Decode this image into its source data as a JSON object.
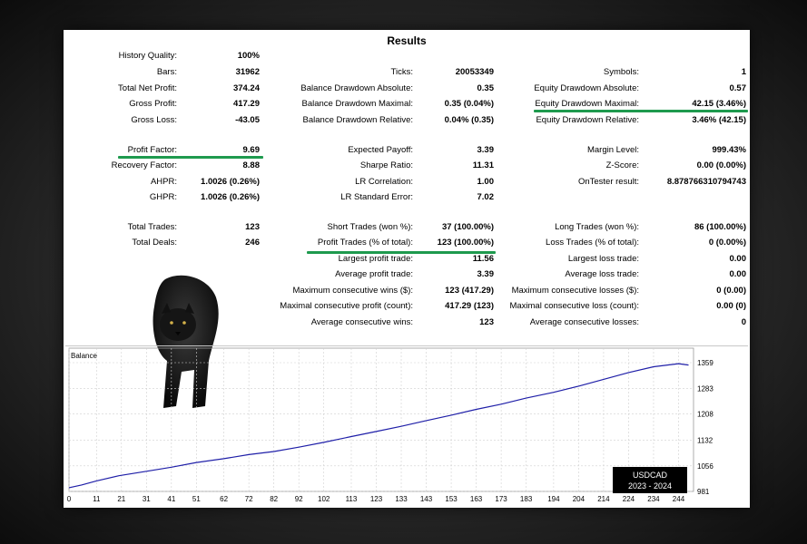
{
  "title": "Results",
  "col1": [
    {
      "label": "History Quality:",
      "value": "100%"
    },
    {
      "label": "Bars:",
      "value": "31962"
    },
    {
      "label": "Total Net Profit:",
      "value": "374.24"
    },
    {
      "label": "Gross Profit:",
      "value": "417.29"
    },
    {
      "label": "Gross Loss:",
      "value": "-43.05"
    },
    {
      "label": "Profit Factor:",
      "value": "9.69"
    },
    {
      "label": "Recovery Factor:",
      "value": "8.88"
    },
    {
      "label": "AHPR:",
      "value": "1.0026 (0.26%)"
    },
    {
      "label": "GHPR:",
      "value": "1.0026 (0.26%)"
    },
    {
      "label": "Total Trades:",
      "value": "123"
    },
    {
      "label": "Total Deals:",
      "value": "246"
    }
  ],
  "col2": [
    {
      "label": "Ticks:",
      "value": "20053349"
    },
    {
      "label": "Balance Drawdown Absolute:",
      "value": "0.35"
    },
    {
      "label": "Balance Drawdown Maximal:",
      "value": "0.35 (0.04%)"
    },
    {
      "label": "Balance Drawdown Relative:",
      "value": "0.04% (0.35)"
    },
    {
      "label": "Expected Payoff:",
      "value": "3.39"
    },
    {
      "label": "Sharpe Ratio:",
      "value": "11.31"
    },
    {
      "label": "LR Correlation:",
      "value": "1.00"
    },
    {
      "label": "LR Standard Error:",
      "value": "7.02"
    },
    {
      "label": "Short Trades (won %):",
      "value": "37 (100.00%)"
    },
    {
      "label": "Profit Trades (% of total):",
      "value": "123 (100.00%)"
    },
    {
      "label": "Largest profit trade:",
      "value": "11.56"
    },
    {
      "label": "Average profit trade:",
      "value": "3.39"
    },
    {
      "label": "Maximum consecutive wins ($):",
      "value": "123 (417.29)"
    },
    {
      "label": "Maximal consecutive profit (count):",
      "value": "417.29 (123)"
    },
    {
      "label": "Average consecutive wins:",
      "value": "123"
    }
  ],
  "col3": [
    {
      "label": "Symbols:",
      "value": "1"
    },
    {
      "label": "Equity Drawdown Absolute:",
      "value": "0.57"
    },
    {
      "label": "Equity Drawdown Maximal:",
      "value": "42.15 (3.46%)"
    },
    {
      "label": "Equity Drawdown Relative:",
      "value": "3.46% (42.15)"
    },
    {
      "label": "Margin Level:",
      "value": "999.43%"
    },
    {
      "label": "Z-Score:",
      "value": "0.00 (0.00%)"
    },
    {
      "label": "OnTester result:",
      "value": "8.878766310794743"
    },
    {
      "label": "Long Trades (won %):",
      "value": "86 (100.00%)"
    },
    {
      "label": "Loss Trades (% of total):",
      "value": "0 (0.00%)"
    },
    {
      "label": "Largest loss trade:",
      "value": "0.00"
    },
    {
      "label": "Average loss trade:",
      "value": "0.00"
    },
    {
      "label": "Maximum consecutive losses ($):",
      "value": "0 (0.00)"
    },
    {
      "label": "Maximal consecutive loss (count):",
      "value": "0.00 (0)"
    },
    {
      "label": "Average consecutive losses:",
      "value": "0"
    }
  ],
  "badge": {
    "line1": "USDCAD",
    "line2": "2023 - 2024"
  },
  "colors": {
    "accent_underline": "#1e9a4e",
    "balance_line": "#1f1fa8",
    "grid": "#d0d0d0"
  },
  "chart_data": {
    "type": "line",
    "title": "Balance",
    "x_ticks": [
      "0",
      "11",
      "21",
      "31",
      "41",
      "51",
      "62",
      "72",
      "82",
      "92",
      "102",
      "113",
      "123",
      "133",
      "143",
      "153",
      "163",
      "173",
      "183",
      "194",
      "204",
      "214",
      "224",
      "234",
      "244"
    ],
    "y_ticks": [
      "1359",
      "1283",
      "1208",
      "1132",
      "1056",
      "981"
    ],
    "ylim": [
      981,
      1359
    ],
    "xlim": [
      0,
      250
    ],
    "grid": true,
    "series": [
      {
        "x": [
          0,
          5,
          11,
          20,
          31,
          41,
          51,
          62,
          72,
          82,
          92,
          102,
          113,
          123,
          133,
          143,
          153,
          163,
          173,
          183,
          194,
          204,
          214,
          224,
          234,
          244,
          248
        ],
        "y": [
          992,
          1000,
          1012,
          1027,
          1040,
          1052,
          1066,
          1077,
          1089,
          1098,
          1111,
          1125,
          1142,
          1157,
          1172,
          1189,
          1205,
          1222,
          1237,
          1255,
          1272,
          1290,
          1310,
          1330,
          1347,
          1356,
          1352
        ]
      }
    ]
  }
}
